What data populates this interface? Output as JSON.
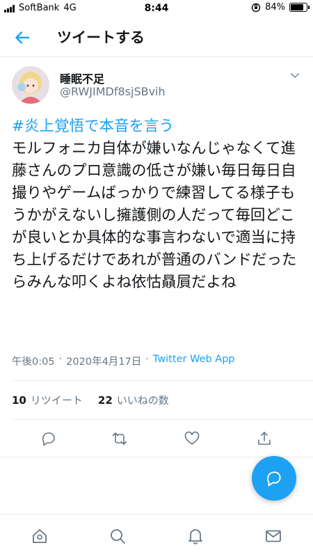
{
  "status_bar": {
    "carrier": "SoftBank",
    "network": "4G",
    "time": "8:44",
    "battery_percent": "84%",
    "battery_level": 0.84
  },
  "header": {
    "title": "ツイートする",
    "back_icon": "back-arrow-icon"
  },
  "tweet": {
    "author_name": "睡眠不足",
    "author_handle": "@RWJIMDf8sjSBvih",
    "hashtag": "#炎上覚悟で本音を言う",
    "text": "モルフォニカ自体が嫌いなんじゃなくて進藤さんのプロ意識の低さが嫌い毎日毎日自撮りやゲームばっかりで練習してる様子もうかがえないし擁護側の人だって毎回どこが良いとか具体的な事言わないで適当に持ち上げるだけであれが普通のバンドだったらみんな叩くよね依怙贔屓だよね",
    "time": "午後0:05",
    "date": "2020年4月17日",
    "separator": "·",
    "source": "Twitter Web App",
    "retweet_count": "10",
    "retweet_label": "リツイート",
    "like_count": "22",
    "like_label": "いいねの数"
  },
  "actions": [
    "reply-icon",
    "retweet-icon",
    "like-icon",
    "share-icon"
  ],
  "tab_bar": [
    "home-icon",
    "search-icon",
    "notifications-icon",
    "messages-icon"
  ],
  "colors": {
    "accent": "#1da1f2",
    "text": "#14171a",
    "secondary": "#657786",
    "divider": "#e6ecf0"
  }
}
